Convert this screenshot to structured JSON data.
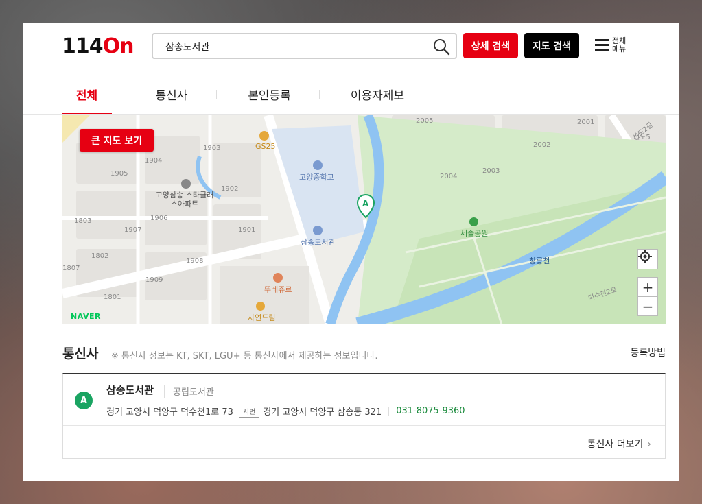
{
  "logo": {
    "num": "114",
    "on": "On"
  },
  "search": {
    "value": "삼송도서관"
  },
  "header": {
    "detail_search": "상세 검색",
    "map_search": "지도 검색",
    "menu_label": "전체 메뉴"
  },
  "tabs": [
    {
      "label": "전체"
    },
    {
      "label": "통신사"
    },
    {
      "label": "본인등록"
    },
    {
      "label": "이용자제보"
    }
  ],
  "map": {
    "big_map_button": "큰 지도 보기",
    "provider": "NAVER",
    "marker": "A",
    "labels": [
      "2005",
      "2001",
      "2002",
      "2003",
      "2004",
      "1903",
      "1904",
      "1905",
      "1902",
      "1906",
      "1907",
      "1901",
      "1803",
      "1802",
      "1807",
      "1908",
      "1909",
      "1801",
      "신도2길",
      "신도5",
      "덕수천2로"
    ],
    "pois": {
      "gs25": "GS25",
      "middle_school": "고양중학교",
      "apartment": "고양삼송 스타클래스아파트",
      "library": "삼송도서관",
      "park": "세솔공원",
      "stream": "창릉천",
      "restaurant": "뚜레쥬르",
      "nature": "자연드림"
    }
  },
  "telecom": {
    "title": "통신사",
    "note": "※ 통신사 정보는 KT, SKT, LGU+ 등 통신사에서 제공하는 정보입니다.",
    "register_link": "등록방법",
    "result": {
      "badge": "A",
      "name": "삼송도서관",
      "category": "공립도서관",
      "road_address": "경기 고양시 덕양구 덕수천1로 73",
      "jibun_tag": "지번",
      "jibun_address": "경기 고양시 덕양구 삼송동 321",
      "phone": "031-8075-9360"
    },
    "more": "통신사 더보기"
  },
  "colors": {
    "brand_red": "#e60012",
    "park_green": "#1aa462",
    "phone_green": "#1a8a3c"
  }
}
